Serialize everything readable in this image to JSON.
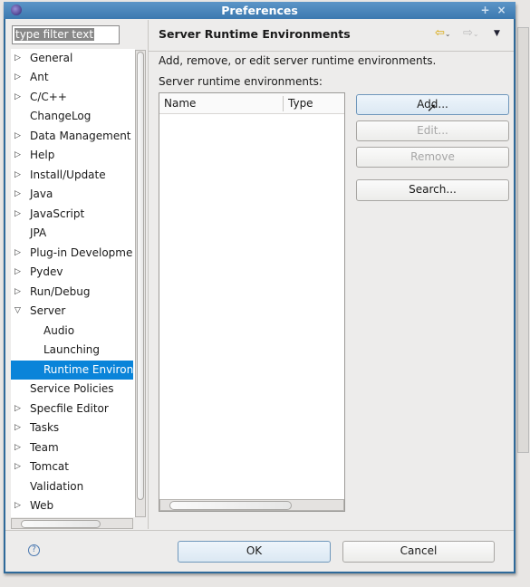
{
  "window": {
    "title": "Preferences"
  },
  "filter": {
    "placeholder": "type filter text"
  },
  "tree": [
    {
      "label": "General",
      "state": "collapsed"
    },
    {
      "label": "Ant",
      "state": "collapsed"
    },
    {
      "label": "C/C++",
      "state": "collapsed"
    },
    {
      "label": "ChangeLog",
      "state": "leaf"
    },
    {
      "label": "Data Management",
      "state": "collapsed"
    },
    {
      "label": "Help",
      "state": "collapsed"
    },
    {
      "label": "Install/Update",
      "state": "collapsed"
    },
    {
      "label": "Java",
      "state": "collapsed"
    },
    {
      "label": "JavaScript",
      "state": "collapsed"
    },
    {
      "label": "JPA",
      "state": "leaf"
    },
    {
      "label": "Plug-in Development",
      "state": "collapsed"
    },
    {
      "label": "Pydev",
      "state": "collapsed"
    },
    {
      "label": "Run/Debug",
      "state": "collapsed"
    },
    {
      "label": "Server",
      "state": "expanded"
    },
    {
      "label": "Audio",
      "state": "child"
    },
    {
      "label": "Launching",
      "state": "child"
    },
    {
      "label": "Runtime Environments",
      "state": "child",
      "selected": true
    },
    {
      "label": "Service Policies",
      "state": "leaf"
    },
    {
      "label": "Specfile Editor",
      "state": "collapsed"
    },
    {
      "label": "Tasks",
      "state": "collapsed"
    },
    {
      "label": "Team",
      "state": "collapsed"
    },
    {
      "label": "Tomcat",
      "state": "collapsed"
    },
    {
      "label": "Validation",
      "state": "leaf"
    },
    {
      "label": "Web",
      "state": "collapsed"
    }
  ],
  "page": {
    "title": "Server Runtime Environments",
    "description": "Add, remove, or edit server runtime environments.",
    "table_label": "Server runtime environments:",
    "columns": [
      "Name",
      "Type"
    ],
    "buttons": {
      "add": "Add...",
      "edit": "Edit...",
      "remove": "Remove",
      "search": "Search..."
    }
  },
  "footer": {
    "ok": "OK",
    "cancel": "Cancel"
  },
  "colors": {
    "selection": "#0a84d9",
    "titlebar": "#3c79b0"
  }
}
